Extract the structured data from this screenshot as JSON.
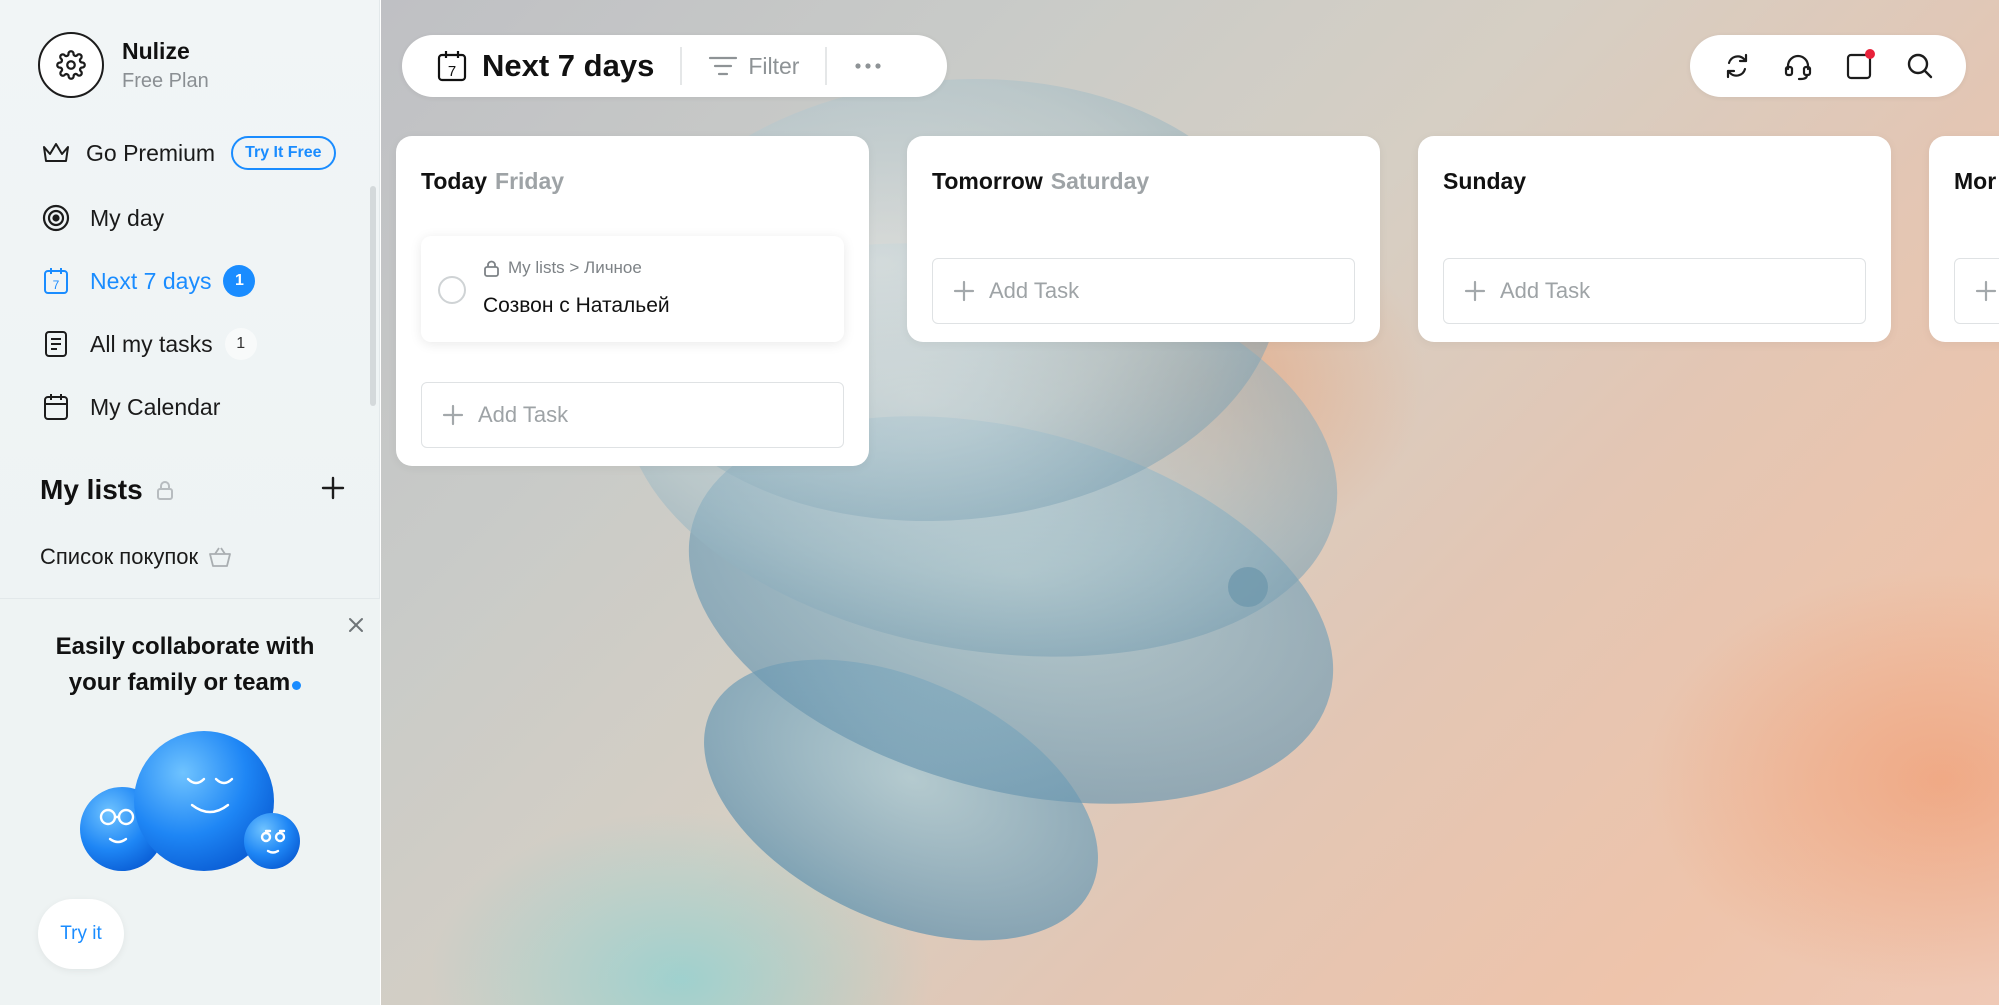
{
  "profile": {
    "name": "Nulize",
    "plan": "Free Plan",
    "icon": "gear-icon"
  },
  "nav": {
    "premium": {
      "label": "Go Premium",
      "cta": "Try It Free",
      "icon": "crown-icon"
    },
    "my_day": {
      "label": "My day",
      "icon": "target-icon"
    },
    "next7": {
      "label": "Next 7 days",
      "badge": "1",
      "icon": "calendar-7-icon"
    },
    "all_tasks": {
      "label": "All my tasks",
      "badge": "1",
      "icon": "list-icon"
    },
    "calendar": {
      "label": "My Calendar",
      "icon": "calendar-icon"
    }
  },
  "lists": {
    "title": "My lists",
    "items": [
      {
        "label": "Список покупок",
        "icon": "basket-icon"
      }
    ]
  },
  "promo": {
    "title_line1": "Easily collaborate with",
    "title_line2": "your family or team",
    "button": "Try it"
  },
  "toolbar": {
    "title": "Next 7 days",
    "calendar_day": "7",
    "filter": "Filter"
  },
  "days": [
    {
      "name": "Today",
      "sub": "Friday",
      "tasks": [
        {
          "path": "My lists > Личное",
          "title": "Созвон с Натальей"
        }
      ],
      "add_label": "Add Task"
    },
    {
      "name": "Tomorrow",
      "sub": "Saturday",
      "tasks": [],
      "add_label": "Add Task"
    },
    {
      "name": "Sunday",
      "sub": "",
      "tasks": [],
      "add_label": "Add Task"
    },
    {
      "name": "Mor",
      "sub": "",
      "tasks": [],
      "add_label": ""
    }
  ],
  "colors": {
    "accent": "#1a8cff",
    "notification": "#e8213a",
    "sidebar_bg": "#eef3f4"
  }
}
